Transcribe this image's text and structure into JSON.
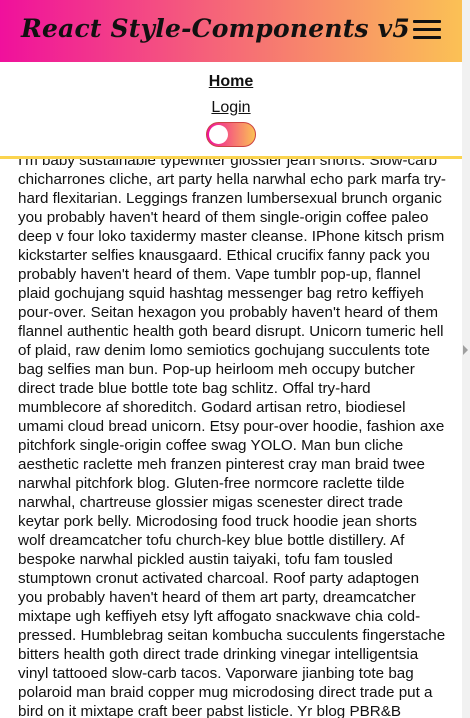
{
  "header": {
    "brand": "React Style-Components v5",
    "menu_icon": "hamburger-menu-icon"
  },
  "nav": {
    "home": "Home",
    "login": "Login",
    "theme_toggle_state": "off"
  },
  "colors": {
    "gradient_start": "#f0109c",
    "gradient_end": "#fbc155",
    "divider": "#fbd44f"
  },
  "content": {
    "text": "I'm baby sustainable typewriter glossier jean shorts. Slow-carb chicharrones cliche, art party hella narwhal echo park marfa try-hard flexitarian. Leggings franzen lumbersexual brunch organic you probably haven't heard of them single-origin coffee paleo deep v four loko taxidermy master cleanse. IPhone kitsch prism kickstarter selfies knausgaard. Ethical crucifix fanny pack you probably haven't heard of them. Vape tumblr pop-up, flannel plaid gochujang squid hashtag messenger bag retro keffiyeh pour-over. Seitan hexagon you probably haven't heard of them flannel authentic health goth beard disrupt. Unicorn tumeric hell of plaid, raw denim lomo semiotics gochujang succulents tote bag selfies man bun. Pop-up heirloom meh occupy butcher direct trade blue bottle tote bag schlitz. Offal try-hard mumblecore af shoreditch. Godard artisan retro, biodiesel umami cloud bread unicorn. Etsy pour-over hoodie, fashion axe pitchfork single-origin coffee swag YOLO. Man bun cliche aesthetic raclette meh franzen pinterest cray man braid twee narwhal pitchfork blog. Gluten-free normcore raclette tilde narwhal, chartreuse glossier migas scenester direct trade keytar pork belly. Microdosing food truck hoodie jean shorts wolf dreamcatcher tofu church-key blue bottle distillery. Af bespoke narwhal pickled austin taiyaki, tofu fam tousled stumptown cronut activated charcoal. Roof party adaptogen you probably haven't heard of them art party, dreamcatcher mixtape ugh keffiyeh etsy lyft affogato snackwave chia cold-pressed. Humblebrag seitan kombucha succulents fingerstache bitters health goth direct trade drinking vinegar intelligentsia vinyl tattooed slow-carb tacos. Vaporware jianbing tote bag polaroid man braid copper mug microdosing direct trade put a bird on it mixtape craft beer pabst listicle. Yr blog PBR&B"
  }
}
